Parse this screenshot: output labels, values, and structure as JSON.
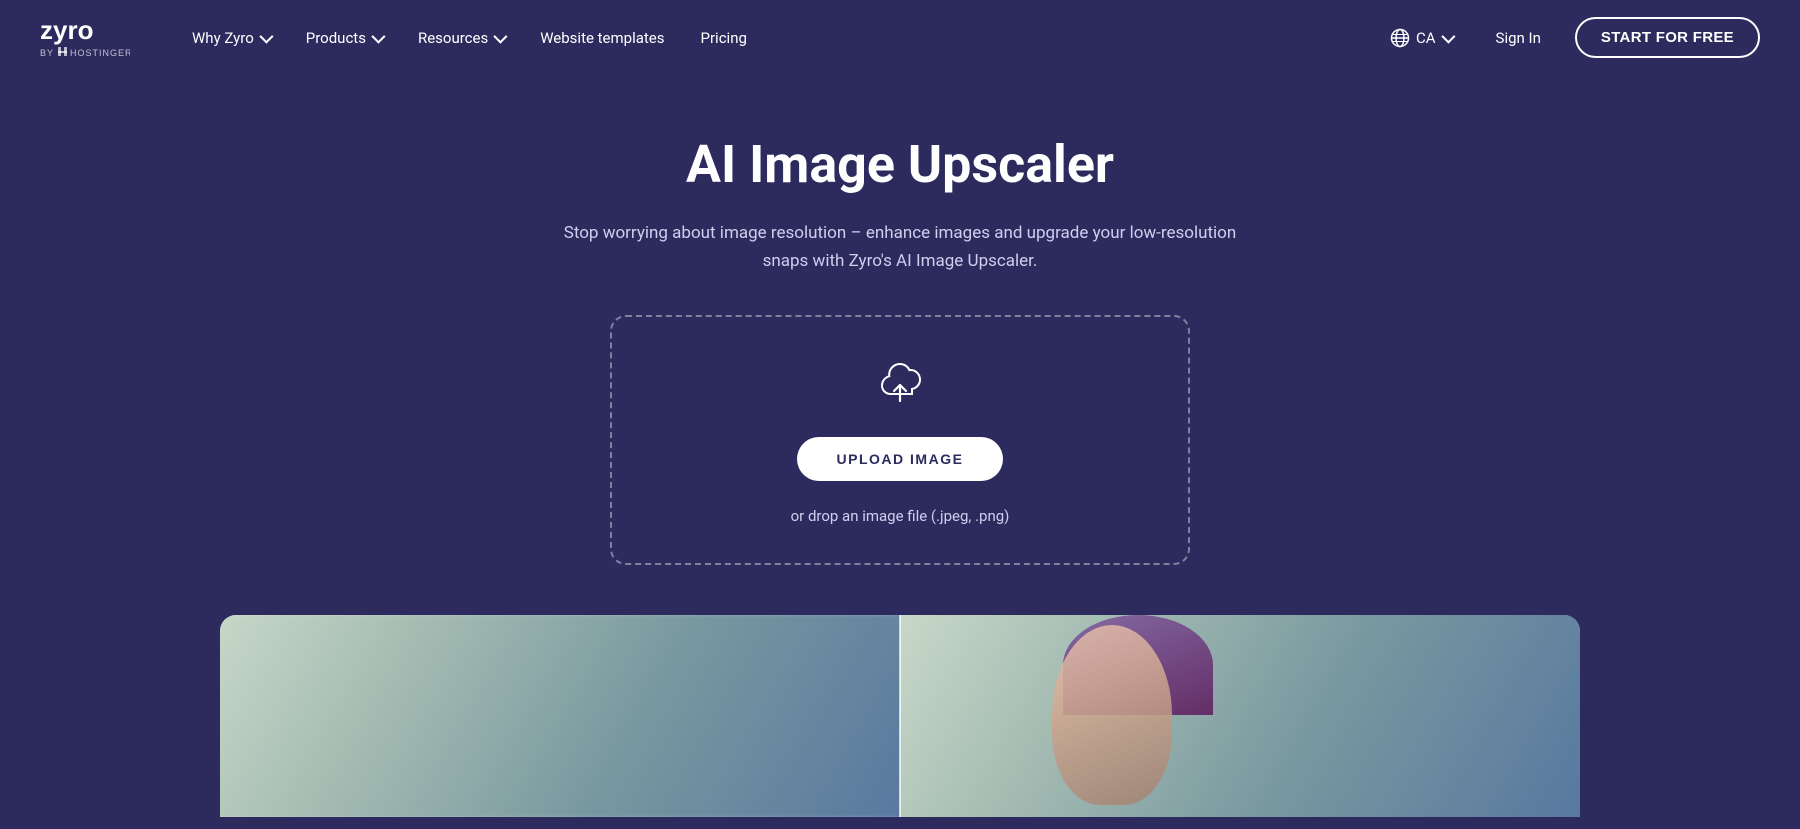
{
  "brand": {
    "name": "Zyro by Hostinger",
    "logo_text": "zyro"
  },
  "nav": {
    "items": [
      {
        "label": "Why Zyro",
        "has_dropdown": true
      },
      {
        "label": "Products",
        "has_dropdown": true
      },
      {
        "label": "Resources",
        "has_dropdown": true
      },
      {
        "label": "Website templates",
        "has_dropdown": false
      },
      {
        "label": "Pricing",
        "has_dropdown": false
      }
    ],
    "locale": "CA",
    "sign_in_label": "Sign In",
    "start_free_label": "START FOR FREE"
  },
  "hero": {
    "title": "AI Image Upscaler",
    "subtitle": "Stop worrying about image resolution – enhance images and upgrade your low-resolution snaps with Zyro's AI Image Upscaler."
  },
  "upload": {
    "button_label": "UPLOAD IMAGE",
    "hint": "or drop an image file (.jpeg, .png)"
  }
}
